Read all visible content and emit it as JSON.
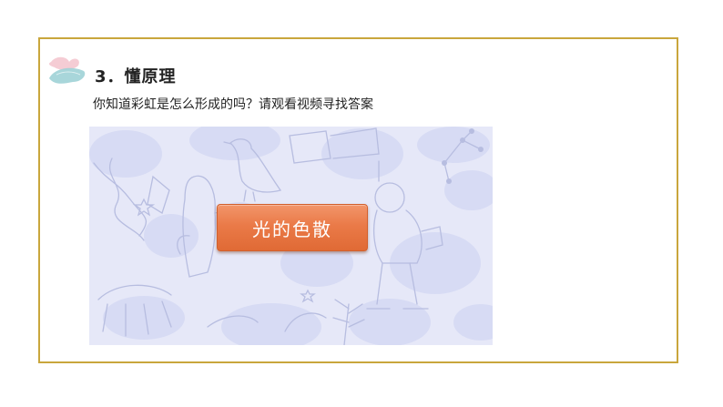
{
  "section": {
    "title": "3．懂原理",
    "question": "你知道彩虹是怎么形成的吗？请观看视频寻找答案"
  },
  "video": {
    "button_label": "光的色散"
  },
  "colors": {
    "frame_border": "#c9a63c",
    "button": "#ea7a48",
    "video_background": "#e6e8f8",
    "brush_pink": "#f4c6cf",
    "brush_teal": "#9fd2d6"
  },
  "icons": {
    "brush_decoration": "brush-stroke-icon"
  }
}
